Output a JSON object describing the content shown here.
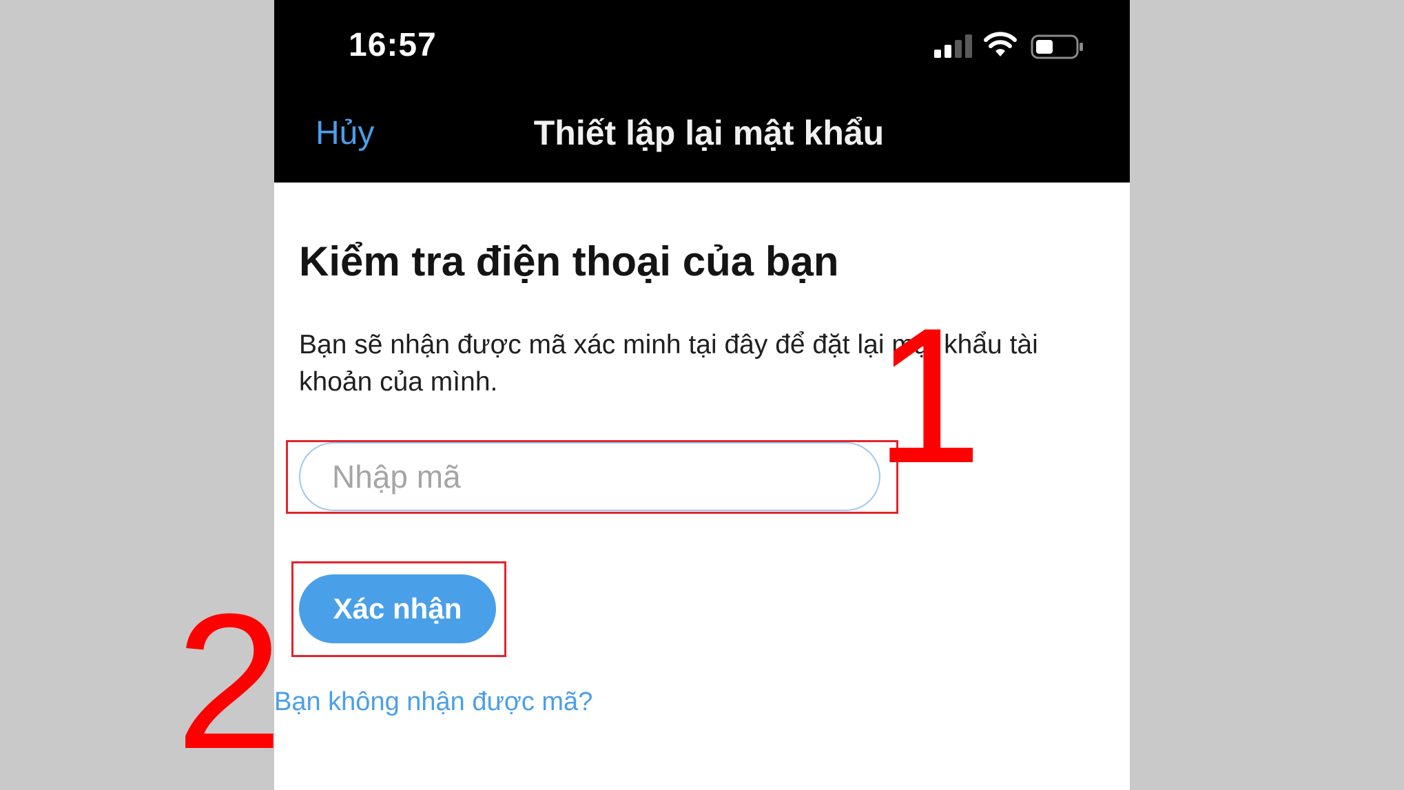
{
  "status_bar": {
    "time": "16:57",
    "icons": [
      "signal-icon",
      "wifi-icon",
      "battery-icon"
    ]
  },
  "nav": {
    "cancel_label": "Hủy",
    "title": "Thiết lập lại mật khẩu"
  },
  "content": {
    "heading": "Kiểm tra điện thoại của bạn",
    "description": "Bạn sẽ nhận được mã xác minh tại đây để đặt lại mật khẩu tài khoản của mình.",
    "code_input": {
      "placeholder": "Nhập mã",
      "value": ""
    },
    "confirm_label": "Xác nhận",
    "resend_link": "Bạn không nhận được mã?"
  },
  "annotations": {
    "step_1": "1",
    "step_2": "2",
    "highlight_color": "#e3232c",
    "number_color": "#ff0000"
  },
  "colors": {
    "accent": "#4a9fe9",
    "bar_background": "#000000",
    "page_background": "#c9c9c9"
  }
}
